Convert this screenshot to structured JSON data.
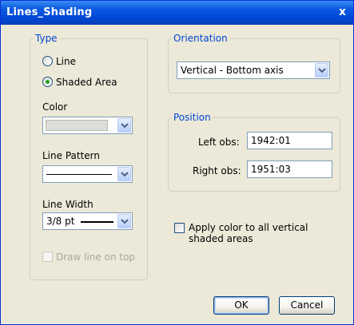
{
  "window": {
    "title": "Lines_Shading",
    "close_glyph": "x"
  },
  "type_group": {
    "label": "Type",
    "options": [
      {
        "label": "Line",
        "selected": false
      },
      {
        "label": "Shaded Area",
        "selected": true
      }
    ],
    "color_label": "Color",
    "line_pattern_label": "Line Pattern",
    "line_width_label": "Line Width",
    "line_width_value": "3/8 pt",
    "draw_on_top_label": "Draw line on top",
    "draw_on_top_checked": false,
    "draw_on_top_enabled": false
  },
  "orientation_group": {
    "label": "Orientation",
    "value": "Vertical - Bottom axis"
  },
  "position_group": {
    "label": "Position",
    "left_label": "Left obs:",
    "left_value": "1942:01",
    "right_label": "Right obs:",
    "right_value": "1951:03"
  },
  "apply_all": {
    "line1": "Apply color to all vertical",
    "line2": "shaded areas",
    "checked": false
  },
  "buttons": {
    "ok": "OK",
    "cancel": "Cancel"
  },
  "colors": {
    "title_bar": "#0a58e0",
    "group_label": "#0046d5",
    "dialog_bg": "#ece9d8",
    "radio_dot": "#21a121"
  },
  "icons": {
    "dropdown": "chevron-down-icon",
    "close": "close-icon"
  }
}
